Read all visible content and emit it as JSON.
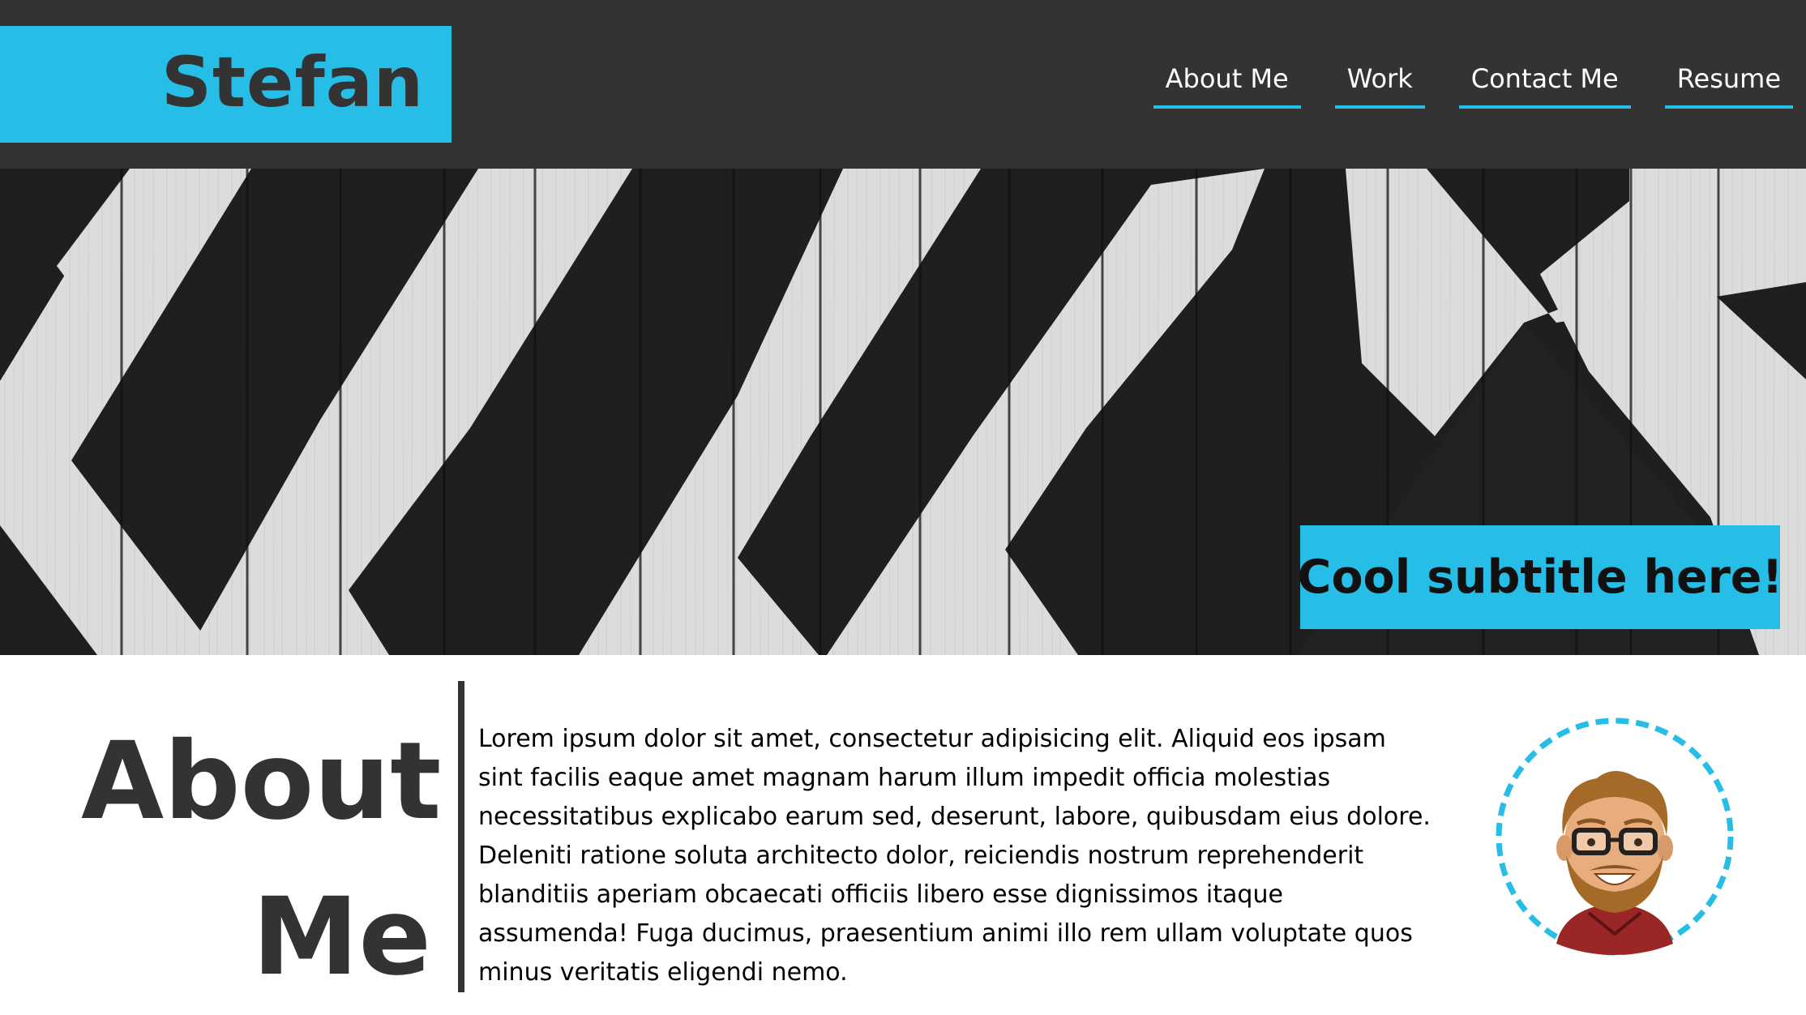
{
  "brand": {
    "name": "Stefan",
    "accent_color": "#26bde6",
    "header_color": "#333333"
  },
  "nav": {
    "items": [
      {
        "label": "About Me"
      },
      {
        "label": "Work"
      },
      {
        "label": "Contact Me"
      },
      {
        "label": "Resume"
      }
    ]
  },
  "hero": {
    "image": "black-and-white-painted-wooden-planks-chevron",
    "subtitle": "Cool subtitle here!"
  },
  "about": {
    "heading_line1": "About",
    "heading_line2": "Me",
    "body": "Lorem ipsum dolor sit amet, consectetur adipisicing elit. Aliquid eos ipsam sint facilis eaque amet magnam harum illum impedit officia molestias necessitatibus explicabo earum sed, deserunt, labore, quibusdam eius dolore. Deleniti ratione soluta architecto dolor, reiciendis nostrum reprehenderit blanditiis aperiam obcaecati officiis libero esse dignissimos itaque assumenda! Fuga ducimus, praesentium animi illo rem ullam voluptate quos minus veritatis eligendi nemo.",
    "avatar": "bitmoji-avatar-bearded-man-with-glasses"
  }
}
